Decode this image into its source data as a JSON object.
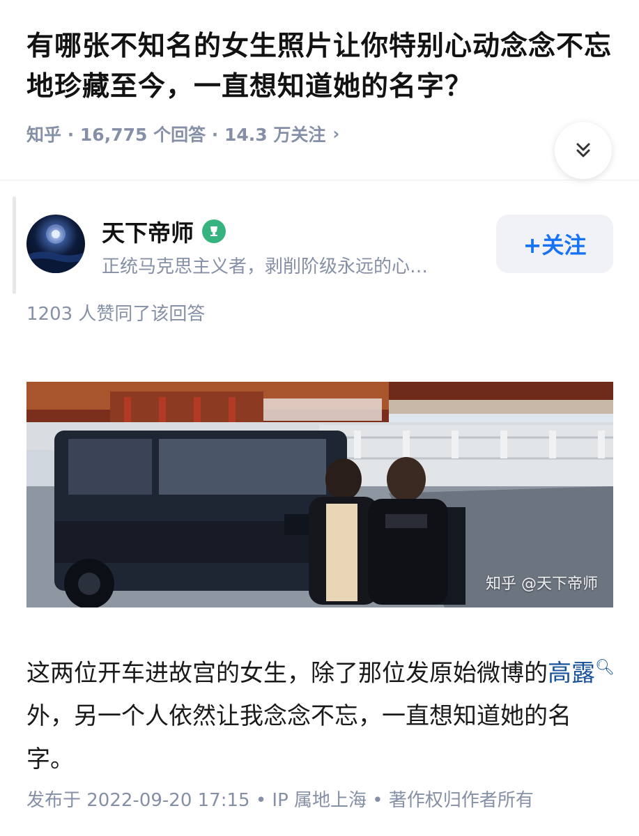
{
  "question": {
    "title": "有哪张不知名的女生照片让你特别心动念念不忘地珍藏至今，一直想知道她的名字？",
    "meta": "知乎 · 16,775 个回答 · 14.3 万关注"
  },
  "author": {
    "name": "天下帝师",
    "bio": "正统马克思主义者，剥削阶级永远的心…",
    "follow_label": "+关注"
  },
  "answer": {
    "votes": "1203 人赞同了该回答",
    "image_watermark": "知乎 @天下帝师",
    "text_before": "这两位开车进故宫的女生，除了那位发原始微博的",
    "link_text": "高露",
    "text_after": "外，另一个人依然让我念念不忘，一直想知道她的名字。",
    "post_meta": "发布于 2022-09-20 17:15 • IP 属地上海 • 著作权归作者所有"
  },
  "colors": {
    "accent": "#1772f6",
    "link": "#175199",
    "meta_gray": "#8590a6"
  },
  "icons": {
    "expand": "double-chevron-down-icon",
    "badge": "achievement-badge-icon",
    "search": "search-icon"
  }
}
